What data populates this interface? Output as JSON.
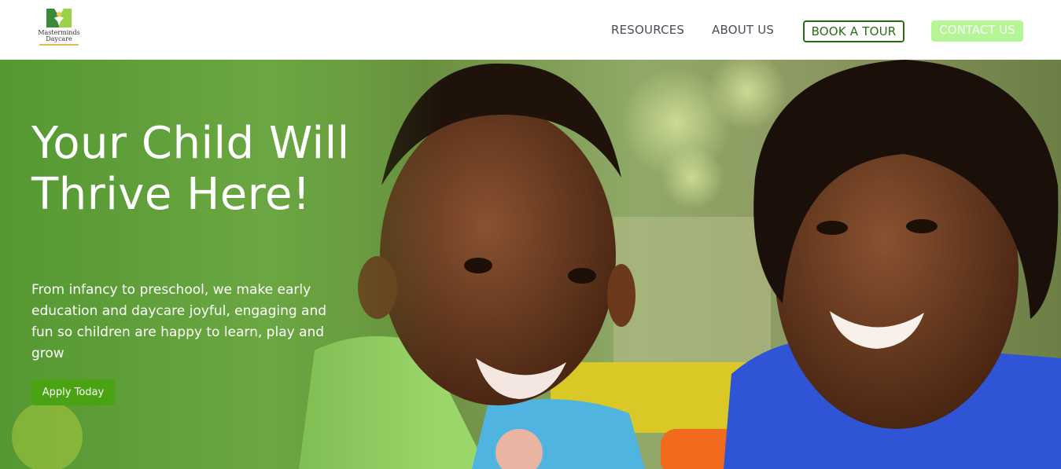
{
  "header": {
    "logo": {
      "line1": "Masterminds",
      "line2": "Daycare",
      "colors": {
        "left": "#3a8a3a",
        "right": "#9ad24a",
        "figure": "#f2c94c"
      }
    },
    "nav": {
      "resources": "RESOURCES",
      "about": "ABOUT US",
      "book_tour": "BOOK A TOUR",
      "contact": "CONTACT US"
    }
  },
  "hero": {
    "title": "Your Child Will Thrive Here!",
    "subtitle": "From infancy to preschool, we make early education and daycare joyful, engaging and fun so children are happy to learn, play and grow",
    "cta": "Apply Today",
    "image_alt": "two-smiling-children-photo"
  },
  "colors": {
    "primary_green": "#4aa313",
    "tour_border": "#2c6b16",
    "contact_bg": "#b6f596",
    "nav_text": "#4a4d5a"
  }
}
